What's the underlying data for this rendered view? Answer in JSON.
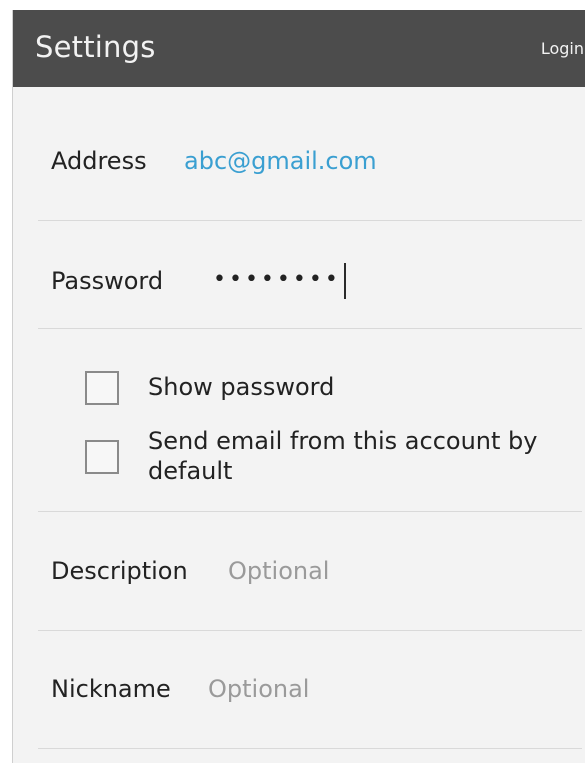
{
  "header": {
    "title": "Settings",
    "login_label": "Login"
  },
  "form": {
    "address": {
      "label": "Address",
      "value": "abc@gmail.com"
    },
    "password": {
      "label": "Password",
      "value": "••••••••"
    },
    "show_password": {
      "label": "Show password",
      "checked": false
    },
    "send_default": {
      "label": "Send email from this account by default",
      "checked": false
    },
    "description": {
      "label": "Description",
      "placeholder": "Optional"
    },
    "nickname": {
      "label": "Nickname",
      "placeholder": "Optional"
    }
  },
  "colors": {
    "header_bg": "#4c4c4c",
    "page_bg": "#f3f3f3",
    "email_text": "#3a9fd1",
    "placeholder_text": "#9a9a9a"
  }
}
